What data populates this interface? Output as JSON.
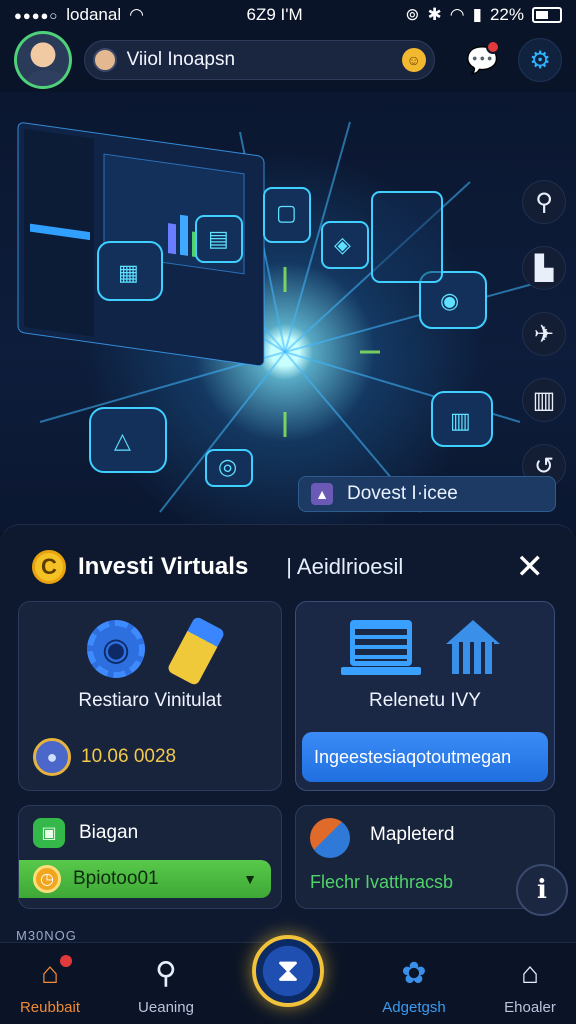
{
  "status_bar": {
    "carrier": "lodanal",
    "time": "6Z9 I'M",
    "battery": "22%"
  },
  "header": {
    "user_name": "Viiol Inoapsn",
    "coin_icon": "coin-icon"
  },
  "hero": {
    "discover_label": "Dovest I·icee"
  },
  "panel": {
    "title": "Investi Virtuals",
    "subtitle": "| Aeidlrioesil",
    "close_label": "✕",
    "card_a": {
      "label": "Restiaro Vinitulat",
      "stat_value": "10.06 0028"
    },
    "card_b": {
      "label": "Relenetu IVY",
      "button_label": "Ingeestesiaqotoutmegan"
    },
    "card_c": {
      "title": "Biagan",
      "select_value": "Bpiotoo01"
    },
    "card_d": {
      "title": "Mapleterd",
      "subtitle": "Flechr Ivatthracsb"
    },
    "footer_note": "M30NOG"
  },
  "bottom_nav": {
    "items": [
      {
        "label": "Reubbait",
        "icon": "home-icon"
      },
      {
        "label": "Ueaning",
        "icon": "search-icon"
      },
      {
        "label": "Adgetgsh",
        "icon": "gear-icon"
      },
      {
        "label": "Ehoaler",
        "icon": "store-icon"
      }
    ]
  },
  "colors": {
    "background": "#0a1428",
    "accent_blue": "#3a8fe8",
    "accent_orange": "#f08a35",
    "accent_green": "#4fd36a",
    "accent_gold": "#f2c23a"
  }
}
